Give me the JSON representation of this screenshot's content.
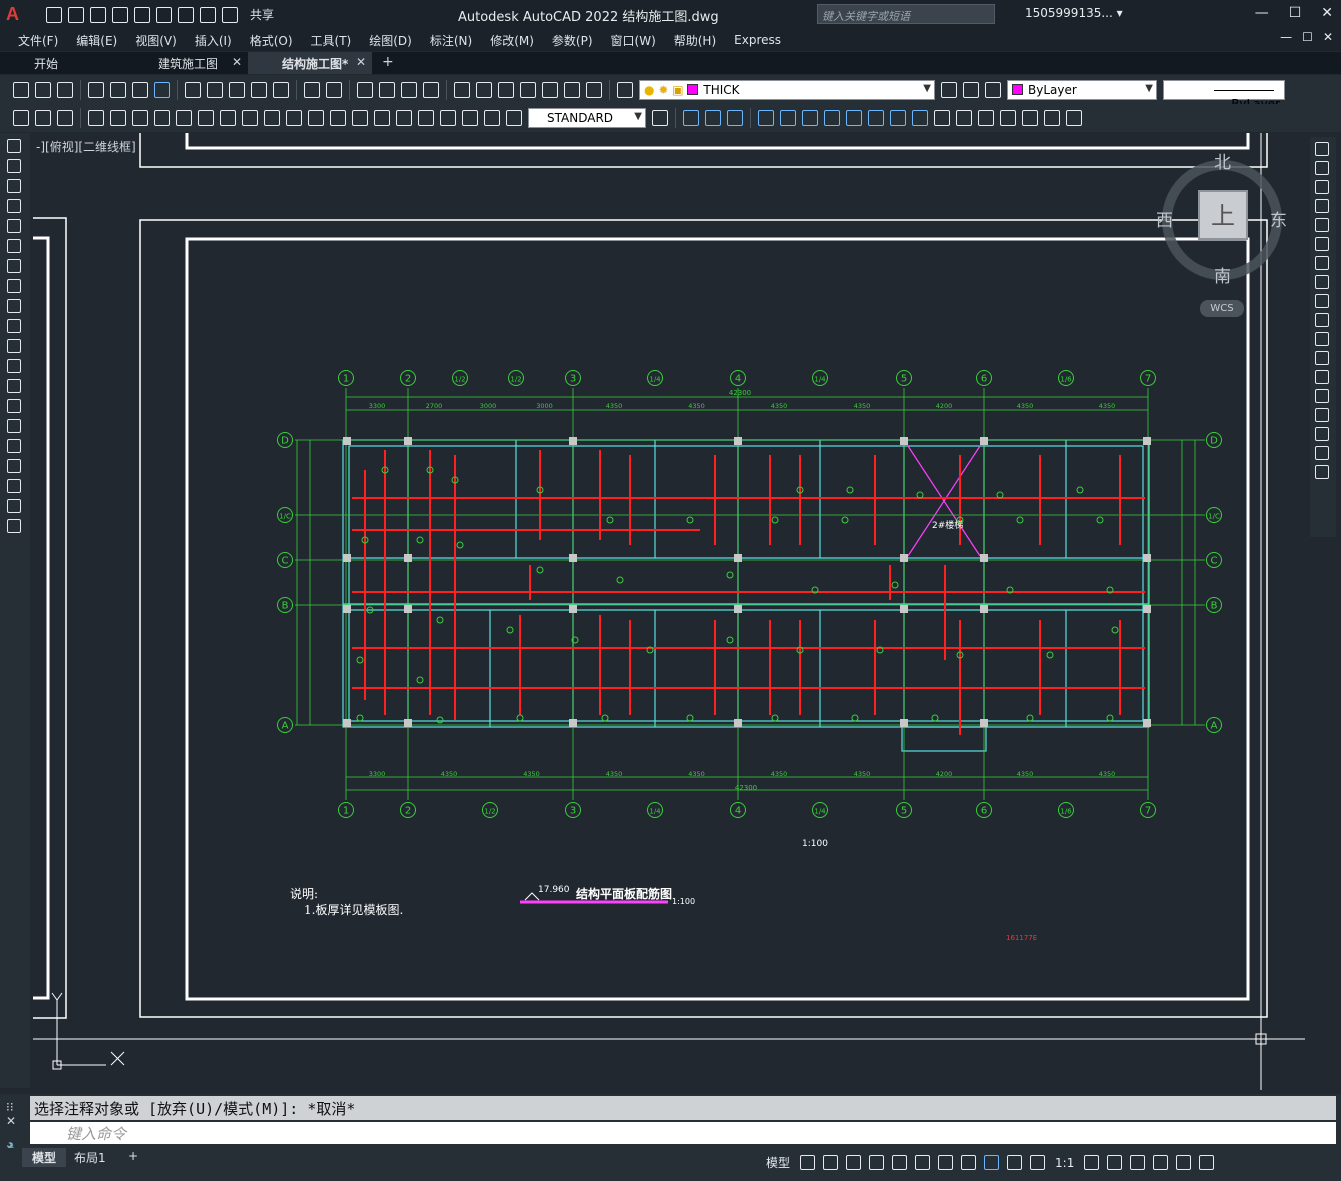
{
  "app": {
    "logo": "A",
    "title": "Autodesk AutoCAD 2022    结构施工图.dwg",
    "share": "共享",
    "search_placeholder": "键入关键字或短语",
    "user": "1505999135... ▾"
  },
  "window_buttons": [
    "—",
    "☐",
    "✕"
  ],
  "menu": [
    "文件(F)",
    "编辑(E)",
    "视图(V)",
    "插入(I)",
    "格式(O)",
    "工具(T)",
    "绘图(D)",
    "标注(N)",
    "修改(M)",
    "参数(P)",
    "窗口(W)",
    "帮助(H)",
    "Express"
  ],
  "tabs": [
    {
      "label": "开始",
      "closable": false
    },
    {
      "label": "建筑施工图",
      "closable": true
    },
    {
      "label": "结构施工图*",
      "closable": true,
      "active": true
    }
  ],
  "toolbar": {
    "layer": "THICK",
    "color": "ByLayer",
    "linetype": "ByLayer",
    "textstyle": "STANDARD"
  },
  "viewport_label": "-][俯视][二维线框]",
  "viewcube": {
    "north": "北",
    "south": "南",
    "east": "东",
    "west": "西",
    "face": "上",
    "wcs": "WCS"
  },
  "drawing": {
    "axis_top": [
      "1",
      "2",
      "1/2",
      "1/2",
      "3",
      "1/4",
      "4",
      "1/4",
      "5",
      "6",
      "1/6",
      "7"
    ],
    "axis_bottom": [
      "1",
      "2",
      "1/2",
      "3",
      "1/4",
      "4",
      "1/4",
      "5",
      "6",
      "1/6",
      "7"
    ],
    "axis_rows": [
      "D",
      "1/C",
      "C",
      "B",
      "A"
    ],
    "dims_top": [
      "3300",
      "2700",
      "3000",
      "3000",
      "4350",
      "4350",
      "4350",
      "4350",
      "4200",
      "4350",
      "4350"
    ],
    "dims_bottom": [
      "3300",
      "4350",
      "4350",
      "4350",
      "4350",
      "4350",
      "4350",
      "4200",
      "4350",
      "4350"
    ],
    "total_top": "42300",
    "total_bottom": "42300",
    "scale_text": "1:100",
    "notes_title": "说明:",
    "notes_line": "1.板厚详见模板图.",
    "plan_title": "结构平面板配筋图",
    "plan_elev": "17.960",
    "plan_scale": "1:100",
    "stair_label": "2#楼梯",
    "corner_note": "161177E"
  },
  "command": {
    "history": "选择注释对象或 [放弃(U)/模式(M)]: *取消*",
    "input_placeholder": "键入命令"
  },
  "layout_tabs": [
    "模型",
    "布局1",
    "+"
  ],
  "status": {
    "model": "模型",
    "scale": "1:1"
  }
}
